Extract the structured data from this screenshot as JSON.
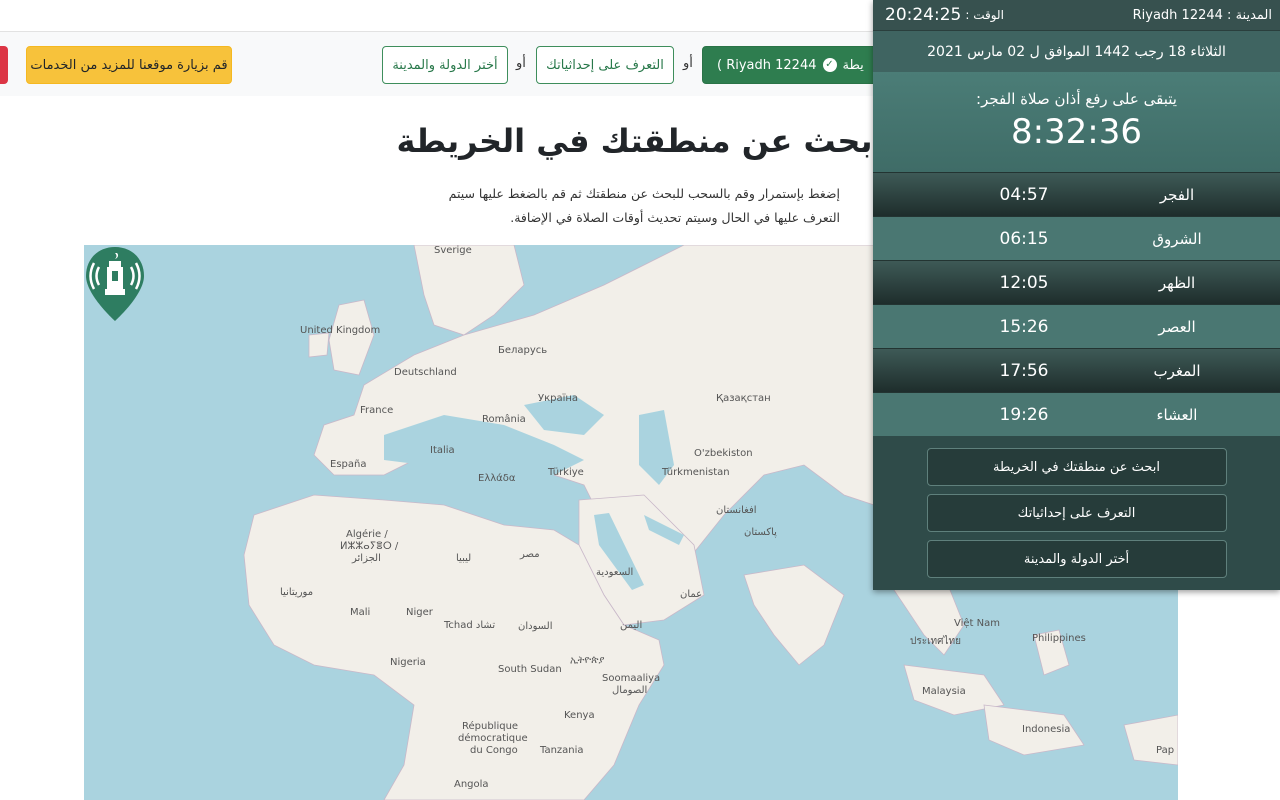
{
  "toolbar": {
    "visit_label": "قم بزيارة موقعنا للمزيد من الخدمات",
    "country_label": "أختر الدولة والمدينة",
    "or_label": "أو",
    "coords_label": "التعرف على إحداثياتك",
    "current_location_label": "( Riyadh 12244",
    "current_location_suffix": "يطة",
    "check_icon_glyph": "✓"
  },
  "main": {
    "title": "ابحث عن منطقتك في الخريطة",
    "description": "إضغط بإستمرار وقم بالسحب للبحث عن منطقتك ثم قم بالضغط عليها سيتم التعرف عليها في الحال وسيتم تحديث أوقات الصلاة في الإضافة."
  },
  "map": {
    "labels": [
      {
        "text": "Sverige"
      },
      {
        "text": "United Kingdom"
      },
      {
        "text": "Беларусь"
      },
      {
        "text": "Deutschland"
      },
      {
        "text": "Україна"
      },
      {
        "text": "Қазақстан"
      },
      {
        "text": "France"
      },
      {
        "text": "România"
      },
      {
        "text": "O'zbekiston"
      },
      {
        "text": "Italia"
      },
      {
        "text": "España"
      },
      {
        "text": "Türkiye"
      },
      {
        "text": "Türkmenistan"
      },
      {
        "text": "Ελλάδα"
      },
      {
        "text": "افغانستان"
      },
      {
        "text": "Algérie /"
      },
      {
        "text": "ⵍⵣⵣⴰⵢⴻⵔ /"
      },
      {
        "text": "الجزائر"
      },
      {
        "text": "ليبيا"
      },
      {
        "text": "مصر"
      },
      {
        "text": "پاکستان"
      },
      {
        "text": "السعودية"
      },
      {
        "text": "عمان"
      },
      {
        "text": "موريتانيا"
      },
      {
        "text": "Mali"
      },
      {
        "text": "Niger"
      },
      {
        "text": "Tchad تشاد"
      },
      {
        "text": "السودان"
      },
      {
        "text": "اليمن"
      },
      {
        "text": "Nigeria"
      },
      {
        "text": "South Sudan"
      },
      {
        "text": "ኢትዮጵያ"
      },
      {
        "text": "Soomaaliya"
      },
      {
        "text": "الصومال"
      },
      {
        "text": "République"
      },
      {
        "text": "démocratique"
      },
      {
        "text": "du Congo"
      },
      {
        "text": "Kenya"
      },
      {
        "text": "Tanzania"
      },
      {
        "text": "Angola"
      },
      {
        "text": "Việt Nam"
      },
      {
        "text": "ประเทศไทย"
      },
      {
        "text": "Philippines"
      },
      {
        "text": "Malaysia"
      },
      {
        "text": "Indonesia"
      },
      {
        "text": "Pap"
      }
    ]
  },
  "panel": {
    "city_label": "المدينة : Riyadh 12244",
    "time_label": "الوقت :",
    "time_value": "20:24:25",
    "date": "الثلاثاء 18 رجب 1442 الموافق ل 02 مارس 2021",
    "countdown_label": "يتبقى على رفع أذان صلاة الفجر:",
    "countdown_value": "8:32:36",
    "prayers": [
      {
        "name": "الفجر",
        "time": "04:57"
      },
      {
        "name": "الشروق",
        "time": "06:15"
      },
      {
        "name": "الظهر",
        "time": "12:05"
      },
      {
        "name": "العصر",
        "time": "15:26"
      },
      {
        "name": "المغرب",
        "time": "17:56"
      },
      {
        "name": "العشاء",
        "time": "19:26"
      }
    ],
    "actions": {
      "map_search": "ابحث عن منطقتك في الخريطة",
      "coords": "التعرف على إحداثياتك",
      "country": "أختر الدولة والمدينة"
    }
  }
}
